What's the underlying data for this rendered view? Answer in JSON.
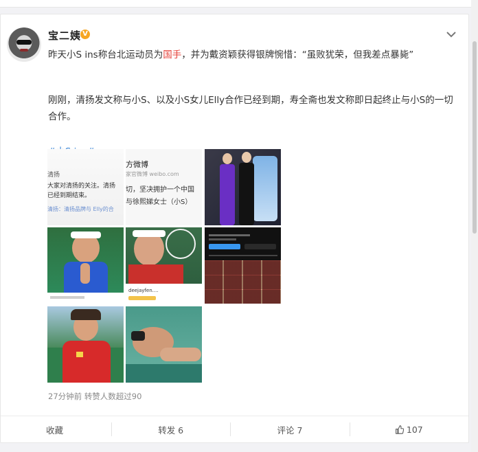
{
  "post": {
    "username": "宝二姨",
    "verified_badge": "V",
    "text_line1_part1": "昨天小S ins称台北运动员为",
    "text_line1_highlight": "国手",
    "text_line1_part2": "，并为戴资颖获得银牌惋惜：“虽败犹荣，但我差点暴毙”",
    "paragraph2": "刚刚，清扬发文称与小S、以及小S女儿Elly合作已经到期，寿全斋也发文称即日起终止与小S的一切合作。",
    "hashtag": "#小S ins#",
    "meta": "27分钟前 转赞人数超过90",
    "accent_red": "#e5433b",
    "link_blue": "#3b86d6"
  },
  "images": {
    "tile1_lines": [
      "清扬",
      "大家对清扬的关注。清扬",
      "已经到期结束。",
      "清扬：清扬品牌与 Elly的合"
    ],
    "tile2_lines": [
      "方微博",
      "家官微博 weibo.com",
      "切，坚决拥护一个中国",
      "与徐熙娣女士（小S）"
    ],
    "tile6_label": "",
    "tile5_caption": "deejayfen....",
    "tile4_caption": ""
  },
  "actions": {
    "collect": "收藏",
    "repost": "转发 6",
    "comment": "评论 7",
    "like": "107"
  },
  "icons": {
    "more": "chevron-down-icon",
    "like": "thumbs-up-icon"
  }
}
